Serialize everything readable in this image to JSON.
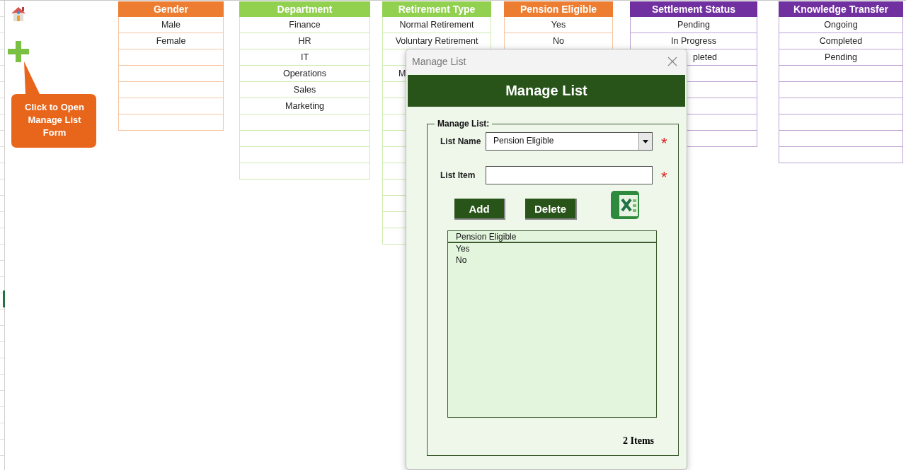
{
  "callout": {
    "text": "Click to Open Manage List Form"
  },
  "lists": [
    {
      "title": "Gender",
      "color": "#ed7d31",
      "cells": [
        {
          "text": "Male"
        },
        {
          "text": "Female"
        },
        {},
        {},
        {},
        {},
        {}
      ]
    },
    {
      "title": "Department",
      "color": "#92d050",
      "cells": [
        {
          "text": "Finance"
        },
        {
          "text": "HR"
        },
        {
          "text": "IT"
        },
        {
          "text": "Operations"
        },
        {
          "text": "Sales"
        },
        {
          "text": "Marketing"
        },
        {},
        {},
        {},
        {}
      ]
    },
    {
      "title": "Retirement Type",
      "color": "#92d050",
      "cells": [
        {
          "text": "Normal Retirement"
        },
        {
          "text": "Voluntary Retirement"
        },
        {},
        {
          "text": "M",
          "kind": "cut_end"
        },
        {},
        {},
        {},
        {},
        {},
        {},
        {},
        {},
        {},
        {}
      ]
    },
    {
      "title": "Pension Eligible",
      "color": "#ed7d31",
      "cells": [
        {
          "text": "Yes"
        },
        {
          "text": "No"
        }
      ]
    },
    {
      "title": "Settlement Status",
      "color": "#7030a0",
      "cells": [
        {
          "text": "Pending"
        },
        {
          "text": "In Progress"
        },
        {
          "text": "pleted",
          "kind": "cut_start"
        },
        {},
        {},
        {},
        {},
        {}
      ]
    },
    {
      "title": "Knowledge Transfer",
      "color": "#7030a0",
      "cells": [
        {
          "text": "Ongoing"
        },
        {
          "text": "Completed"
        },
        {
          "text": "Pending"
        },
        {},
        {},
        {},
        {},
        {},
        {}
      ]
    }
  ],
  "dialog": {
    "title": "Manage List",
    "heading": "Manage List",
    "group_label": "Manage List:",
    "list_name": {
      "label": "List Name",
      "value": "Pension Eligible",
      "required_mark": "*"
    },
    "list_item": {
      "label": "List Item",
      "required_mark": "*"
    },
    "buttons": [
      "Add",
      "Delete"
    ],
    "listbox": {
      "header": "Pension Eligible",
      "items": [
        "Yes",
        "No"
      ]
    },
    "count": "2 Items"
  }
}
